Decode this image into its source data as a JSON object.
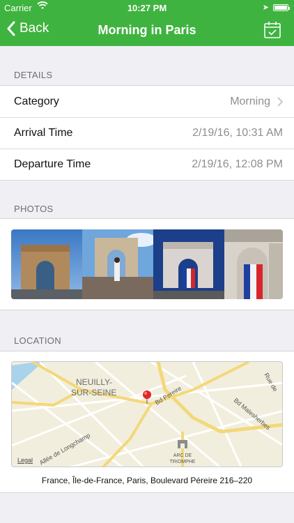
{
  "status": {
    "carrier": "Carrier",
    "time": "10:27 PM"
  },
  "nav": {
    "back_label": "Back",
    "title": "Morning in Paris"
  },
  "sections": {
    "details": "DETAILS",
    "photos": "PHOTOS",
    "location": "LOCATION"
  },
  "details": [
    {
      "label": "Category",
      "value": "Morning"
    },
    {
      "label": "Arrival Time",
      "value": "2/19/16, 10:31 AM"
    },
    {
      "label": "Departure Time",
      "value": "2/19/16, 12:08 PM"
    }
  ],
  "map": {
    "district": "NEUILLY-",
    "district2": "SUR-SEINE",
    "street1": "Bd Pereire",
    "street2": "Bd Malesherbes",
    "street3": "Allée de Longchamp",
    "street4": "Rue de",
    "landmark1": "ARC DE",
    "landmark2": "TRIOMPHE",
    "legal": "Legal"
  },
  "address": "France, Île-de-France, Paris, Boulevard Péreire 216–220",
  "colors": {
    "accent": "#3fb33f"
  }
}
